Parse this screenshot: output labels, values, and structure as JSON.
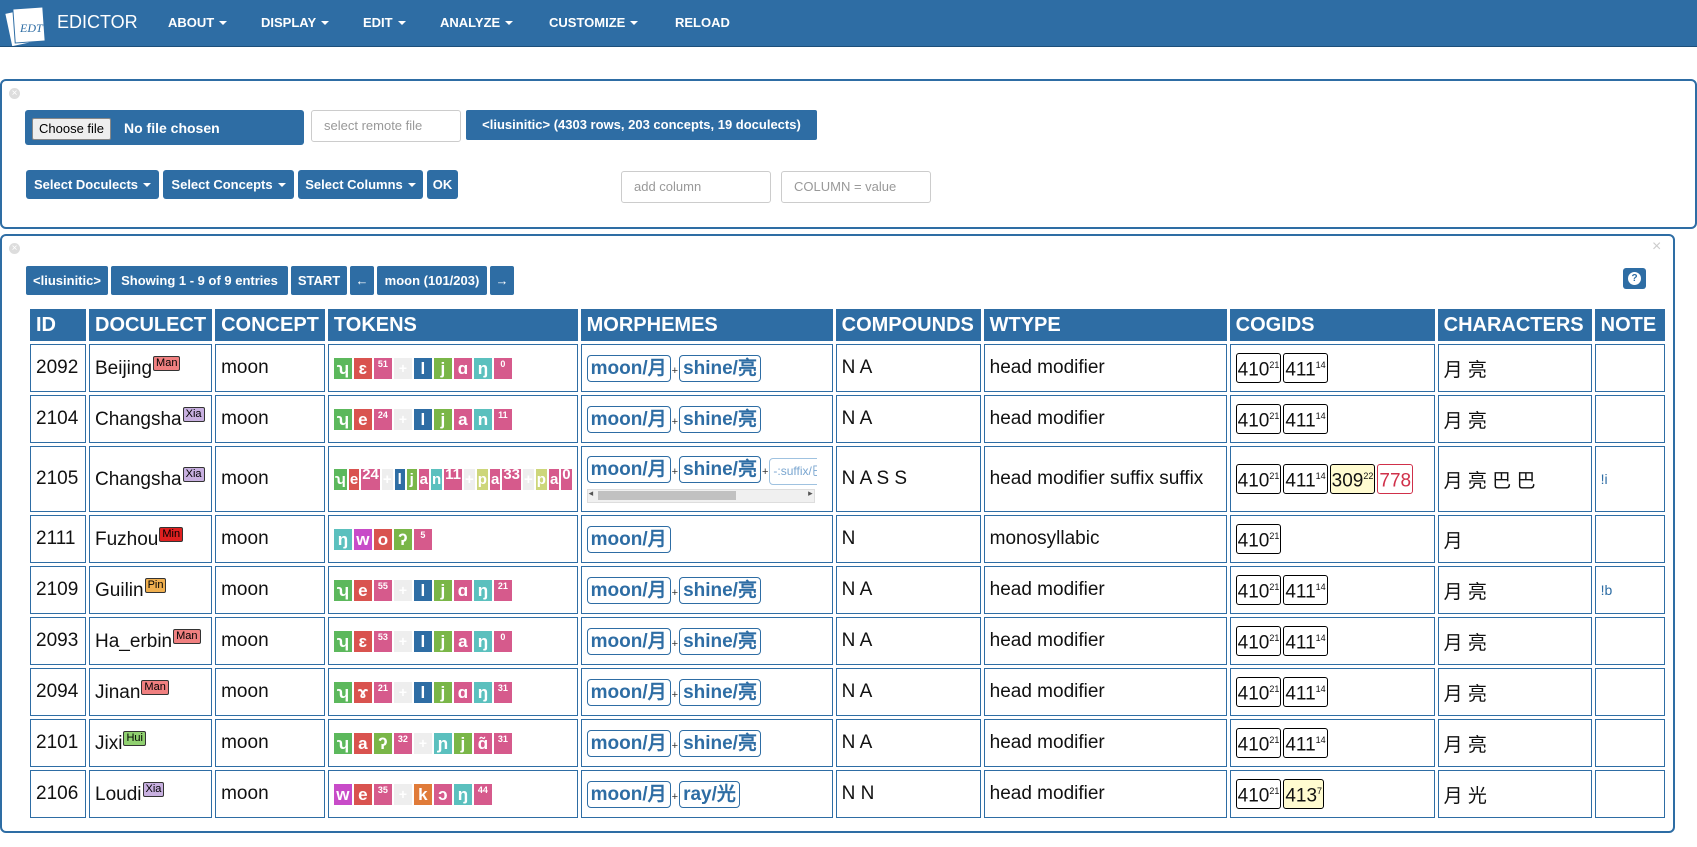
{
  "navbar": {
    "brand": "EDICTOR",
    "menus": [
      "ABOUT",
      "DISPLAY",
      "EDIT",
      "ANALYZE",
      "CUSTOMIZE",
      "RELOAD"
    ]
  },
  "file_panel": {
    "choose_file": "Choose file",
    "no_file": "No file chosen",
    "remote_placeholder": "select remote file",
    "dataset_info": "<liusinitic> (4303 rows, 203 concepts, 19 doculects)",
    "select_doculects": "Select Doculects",
    "select_concepts": "Select Concepts",
    "select_columns": "Select Columns",
    "ok": "OK",
    "add_column_placeholder": "add column",
    "column_value_placeholder": "COLUMN = value"
  },
  "pager": {
    "dataset": "<liusinitic>",
    "showing": "Showing 1 - 9 of 9 entries",
    "start": "START",
    "prev": "←",
    "concept": "moon (101/203)",
    "next": "→",
    "help": "?"
  },
  "columns": [
    "ID",
    "DOCULECT",
    "CONCEPT",
    "TOKENS",
    "MORPHEMES",
    "COMPOUNDS",
    "WTYPE",
    "COGIDS",
    "CHARACTERS",
    "NOTE"
  ],
  "rows": [
    {
      "id": "2092",
      "doculect": "Beijing",
      "tag": "Man",
      "tag_color": "#f08080",
      "concept": "moon",
      "tokens": [
        [
          "ʮ",
          "#5cb85c"
        ],
        [
          "ɛ",
          "#d9534f"
        ],
        [
          "51",
          "#d65a8c",
          "tone"
        ],
        [
          "+",
          "#eee",
          "plus"
        ],
        [
          "l",
          "#2e6da4"
        ],
        [
          "j",
          "#7ab648"
        ],
        [
          "ɑ",
          "#d65a8c"
        ],
        [
          "ŋ",
          "#5bc0be"
        ],
        [
          "0",
          "#d65a8c",
          "tone"
        ]
      ],
      "morphemes": [
        "moon/月",
        "shine/亮"
      ],
      "compounds": "N A",
      "wtype": "head modifier",
      "cogids": [
        [
          "410",
          "21",
          ""
        ],
        [
          "411",
          "14",
          ""
        ]
      ],
      "characters": "月 亮",
      "note": ""
    },
    {
      "id": "2104",
      "doculect": "Changsha",
      "tag": "Xia",
      "tag_color": "#c8b0e0",
      "concept": "moon",
      "tokens": [
        [
          "ʮ",
          "#5cb85c"
        ],
        [
          "e",
          "#d9534f"
        ],
        [
          "24",
          "#d65a8c",
          "tone"
        ],
        [
          "+",
          "#eee",
          "plus"
        ],
        [
          "l",
          "#2e6da4"
        ],
        [
          "j",
          "#7ab648"
        ],
        [
          "a",
          "#d65a8c"
        ],
        [
          "n",
          "#5bc0be"
        ],
        [
          "11",
          "#d65a8c",
          "tone"
        ]
      ],
      "morphemes": [
        "moon/月",
        "shine/亮"
      ],
      "compounds": "N A",
      "wtype": "head modifier",
      "cogids": [
        [
          "410",
          "21",
          ""
        ],
        [
          "411",
          "14",
          ""
        ]
      ],
      "characters": "月 亮",
      "note": ""
    },
    {
      "id": "2105",
      "doculect": "Changsha",
      "tag": "Xia",
      "tag_color": "#c8b0e0",
      "concept": "moon",
      "tokens": [
        [
          "ʮ",
          "#5cb85c"
        ],
        [
          "e",
          "#d9534f"
        ],
        [
          "24",
          "#d65a8c",
          "tone"
        ],
        [
          "+",
          "#eee",
          "plus"
        ],
        [
          "l",
          "#2e6da4"
        ],
        [
          "j",
          "#7ab648"
        ],
        [
          "a",
          "#d65a8c"
        ],
        [
          "n",
          "#5bc0be"
        ],
        [
          "11",
          "#d65a8c",
          "tone"
        ],
        [
          "+",
          "#eee",
          "plus"
        ],
        [
          "p",
          "#cdd67a"
        ],
        [
          "a",
          "#d65a8c"
        ],
        [
          "33",
          "#d65a8c",
          "tone"
        ],
        [
          "+",
          "#eee",
          "plus"
        ],
        [
          "p",
          "#cdd67a"
        ],
        [
          "a",
          "#d65a8c"
        ],
        [
          "0",
          "#d65a8c",
          "tone"
        ]
      ],
      "morphemes": [
        "moon/月",
        "shine/亮",
        "-:suffix/巴"
      ],
      "compounds": "N A S S",
      "wtype": "head modifier suffix suffix",
      "cogids": [
        [
          "410",
          "21",
          ""
        ],
        [
          "411",
          "14",
          ""
        ],
        [
          "309",
          "22",
          "#fffbd0"
        ],
        [
          "778",
          "",
          "#fff"
        ]
      ],
      "characters": "月 亮 巴 巴",
      "note": "!i"
    },
    {
      "id": "2111",
      "doculect": "Fuzhou",
      "tag": "Min",
      "tag_color": "#e02020",
      "concept": "moon",
      "tokens": [
        [
          "ŋ",
          "#5bc0be"
        ],
        [
          "w",
          "#c84bc8"
        ],
        [
          "o",
          "#d9534f"
        ],
        [
          "ʔ",
          "#7ab648"
        ],
        [
          "5",
          "#d65a8c",
          "tone"
        ]
      ],
      "morphemes": [
        "moon/月"
      ],
      "compounds": "N",
      "wtype": "monosyllabic",
      "cogids": [
        [
          "410",
          "21",
          ""
        ]
      ],
      "characters": "月",
      "note": ""
    },
    {
      "id": "2109",
      "doculect": "Guilin",
      "tag": "Pin",
      "tag_color": "#f0b050",
      "concept": "moon",
      "tokens": [
        [
          "ʮ",
          "#5cb85c"
        ],
        [
          "e",
          "#d9534f"
        ],
        [
          "55",
          "#d65a8c",
          "tone"
        ],
        [
          "+",
          "#eee",
          "plus"
        ],
        [
          "l",
          "#2e6da4"
        ],
        [
          "j",
          "#7ab648"
        ],
        [
          "ɑ",
          "#d65a8c"
        ],
        [
          "ŋ",
          "#5bc0be"
        ],
        [
          "21",
          "#d65a8c",
          "tone"
        ]
      ],
      "morphemes": [
        "moon/月",
        "shine/亮"
      ],
      "compounds": "N A",
      "wtype": "head modifier",
      "cogids": [
        [
          "410",
          "21",
          ""
        ],
        [
          "411",
          "14",
          ""
        ]
      ],
      "characters": "月 亮",
      "note": "!b"
    },
    {
      "id": "2093",
      "doculect": "Ha_erbin",
      "tag": "Man",
      "tag_color": "#f08080",
      "concept": "moon",
      "tokens": [
        [
          "ʮ",
          "#5cb85c"
        ],
        [
          "ɛ",
          "#d9534f"
        ],
        [
          "53",
          "#d65a8c",
          "tone"
        ],
        [
          "+",
          "#eee",
          "plus"
        ],
        [
          "l",
          "#2e6da4"
        ],
        [
          "j",
          "#7ab648"
        ],
        [
          "a",
          "#d65a8c"
        ],
        [
          "ŋ",
          "#5bc0be"
        ],
        [
          "0",
          "#d65a8c",
          "tone"
        ]
      ],
      "morphemes": [
        "moon/月",
        "shine/亮"
      ],
      "compounds": "N A",
      "wtype": "head modifier",
      "cogids": [
        [
          "410",
          "21",
          ""
        ],
        [
          "411",
          "14",
          ""
        ]
      ],
      "characters": "月 亮",
      "note": ""
    },
    {
      "id": "2094",
      "doculect": "Jinan",
      "tag": "Man",
      "tag_color": "#f08080",
      "concept": "moon",
      "tokens": [
        [
          "ʮ",
          "#5cb85c"
        ],
        [
          "ɤ",
          "#d9534f"
        ],
        [
          "21",
          "#d65a8c",
          "tone"
        ],
        [
          "+",
          "#eee",
          "plus"
        ],
        [
          "l",
          "#2e6da4"
        ],
        [
          "j",
          "#7ab648"
        ],
        [
          "ɑ",
          "#d65a8c"
        ],
        [
          "ŋ",
          "#5bc0be"
        ],
        [
          "31",
          "#d65a8c",
          "tone"
        ]
      ],
      "morphemes": [
        "moon/月",
        "shine/亮"
      ],
      "compounds": "N A",
      "wtype": "head modifier",
      "cogids": [
        [
          "410",
          "21",
          ""
        ],
        [
          "411",
          "14",
          ""
        ]
      ],
      "characters": "月 亮",
      "note": ""
    },
    {
      "id": "2101",
      "doculect": "Jixi",
      "tag": "Hui",
      "tag_color": "#90d070",
      "concept": "moon",
      "tokens": [
        [
          "ʮ",
          "#5cb85c"
        ],
        [
          "a",
          "#d9534f"
        ],
        [
          "ʔ",
          "#7ab648"
        ],
        [
          "32",
          "#d65a8c",
          "tone"
        ],
        [
          "+",
          "#eee",
          "plus"
        ],
        [
          "ɲ",
          "#5bc0be"
        ],
        [
          "j",
          "#7ab648"
        ],
        [
          "ɑ̃",
          "#d65a8c"
        ],
        [
          "31",
          "#d65a8c",
          "tone"
        ]
      ],
      "morphemes": [
        "moon/月",
        "shine/亮"
      ],
      "compounds": "N A",
      "wtype": "head modifier",
      "cogids": [
        [
          "410",
          "21",
          ""
        ],
        [
          "411",
          "14",
          ""
        ]
      ],
      "characters": "月 亮",
      "note": ""
    },
    {
      "id": "2106",
      "doculect": "Loudi",
      "tag": "Xia",
      "tag_color": "#c8b0e0",
      "concept": "moon",
      "tokens": [
        [
          "w",
          "#c84bc8"
        ],
        [
          "e",
          "#d9534f"
        ],
        [
          "35",
          "#d65a8c",
          "tone"
        ],
        [
          "+",
          "#eee",
          "plus"
        ],
        [
          "k",
          "#e07b39"
        ],
        [
          "ɔ",
          "#d65a8c"
        ],
        [
          "ŋ",
          "#5bc0be"
        ],
        [
          "44",
          "#d65a8c",
          "tone"
        ]
      ],
      "morphemes": [
        "moon/月",
        "ray/光"
      ],
      "compounds": "N N",
      "wtype": "head modifier",
      "cogids": [
        [
          "410",
          "21",
          ""
        ],
        [
          "413",
          "7",
          "#fffbd0"
        ]
      ],
      "characters": "月 光",
      "note": ""
    }
  ],
  "colors": {
    "brand": "#2e6da4"
  }
}
